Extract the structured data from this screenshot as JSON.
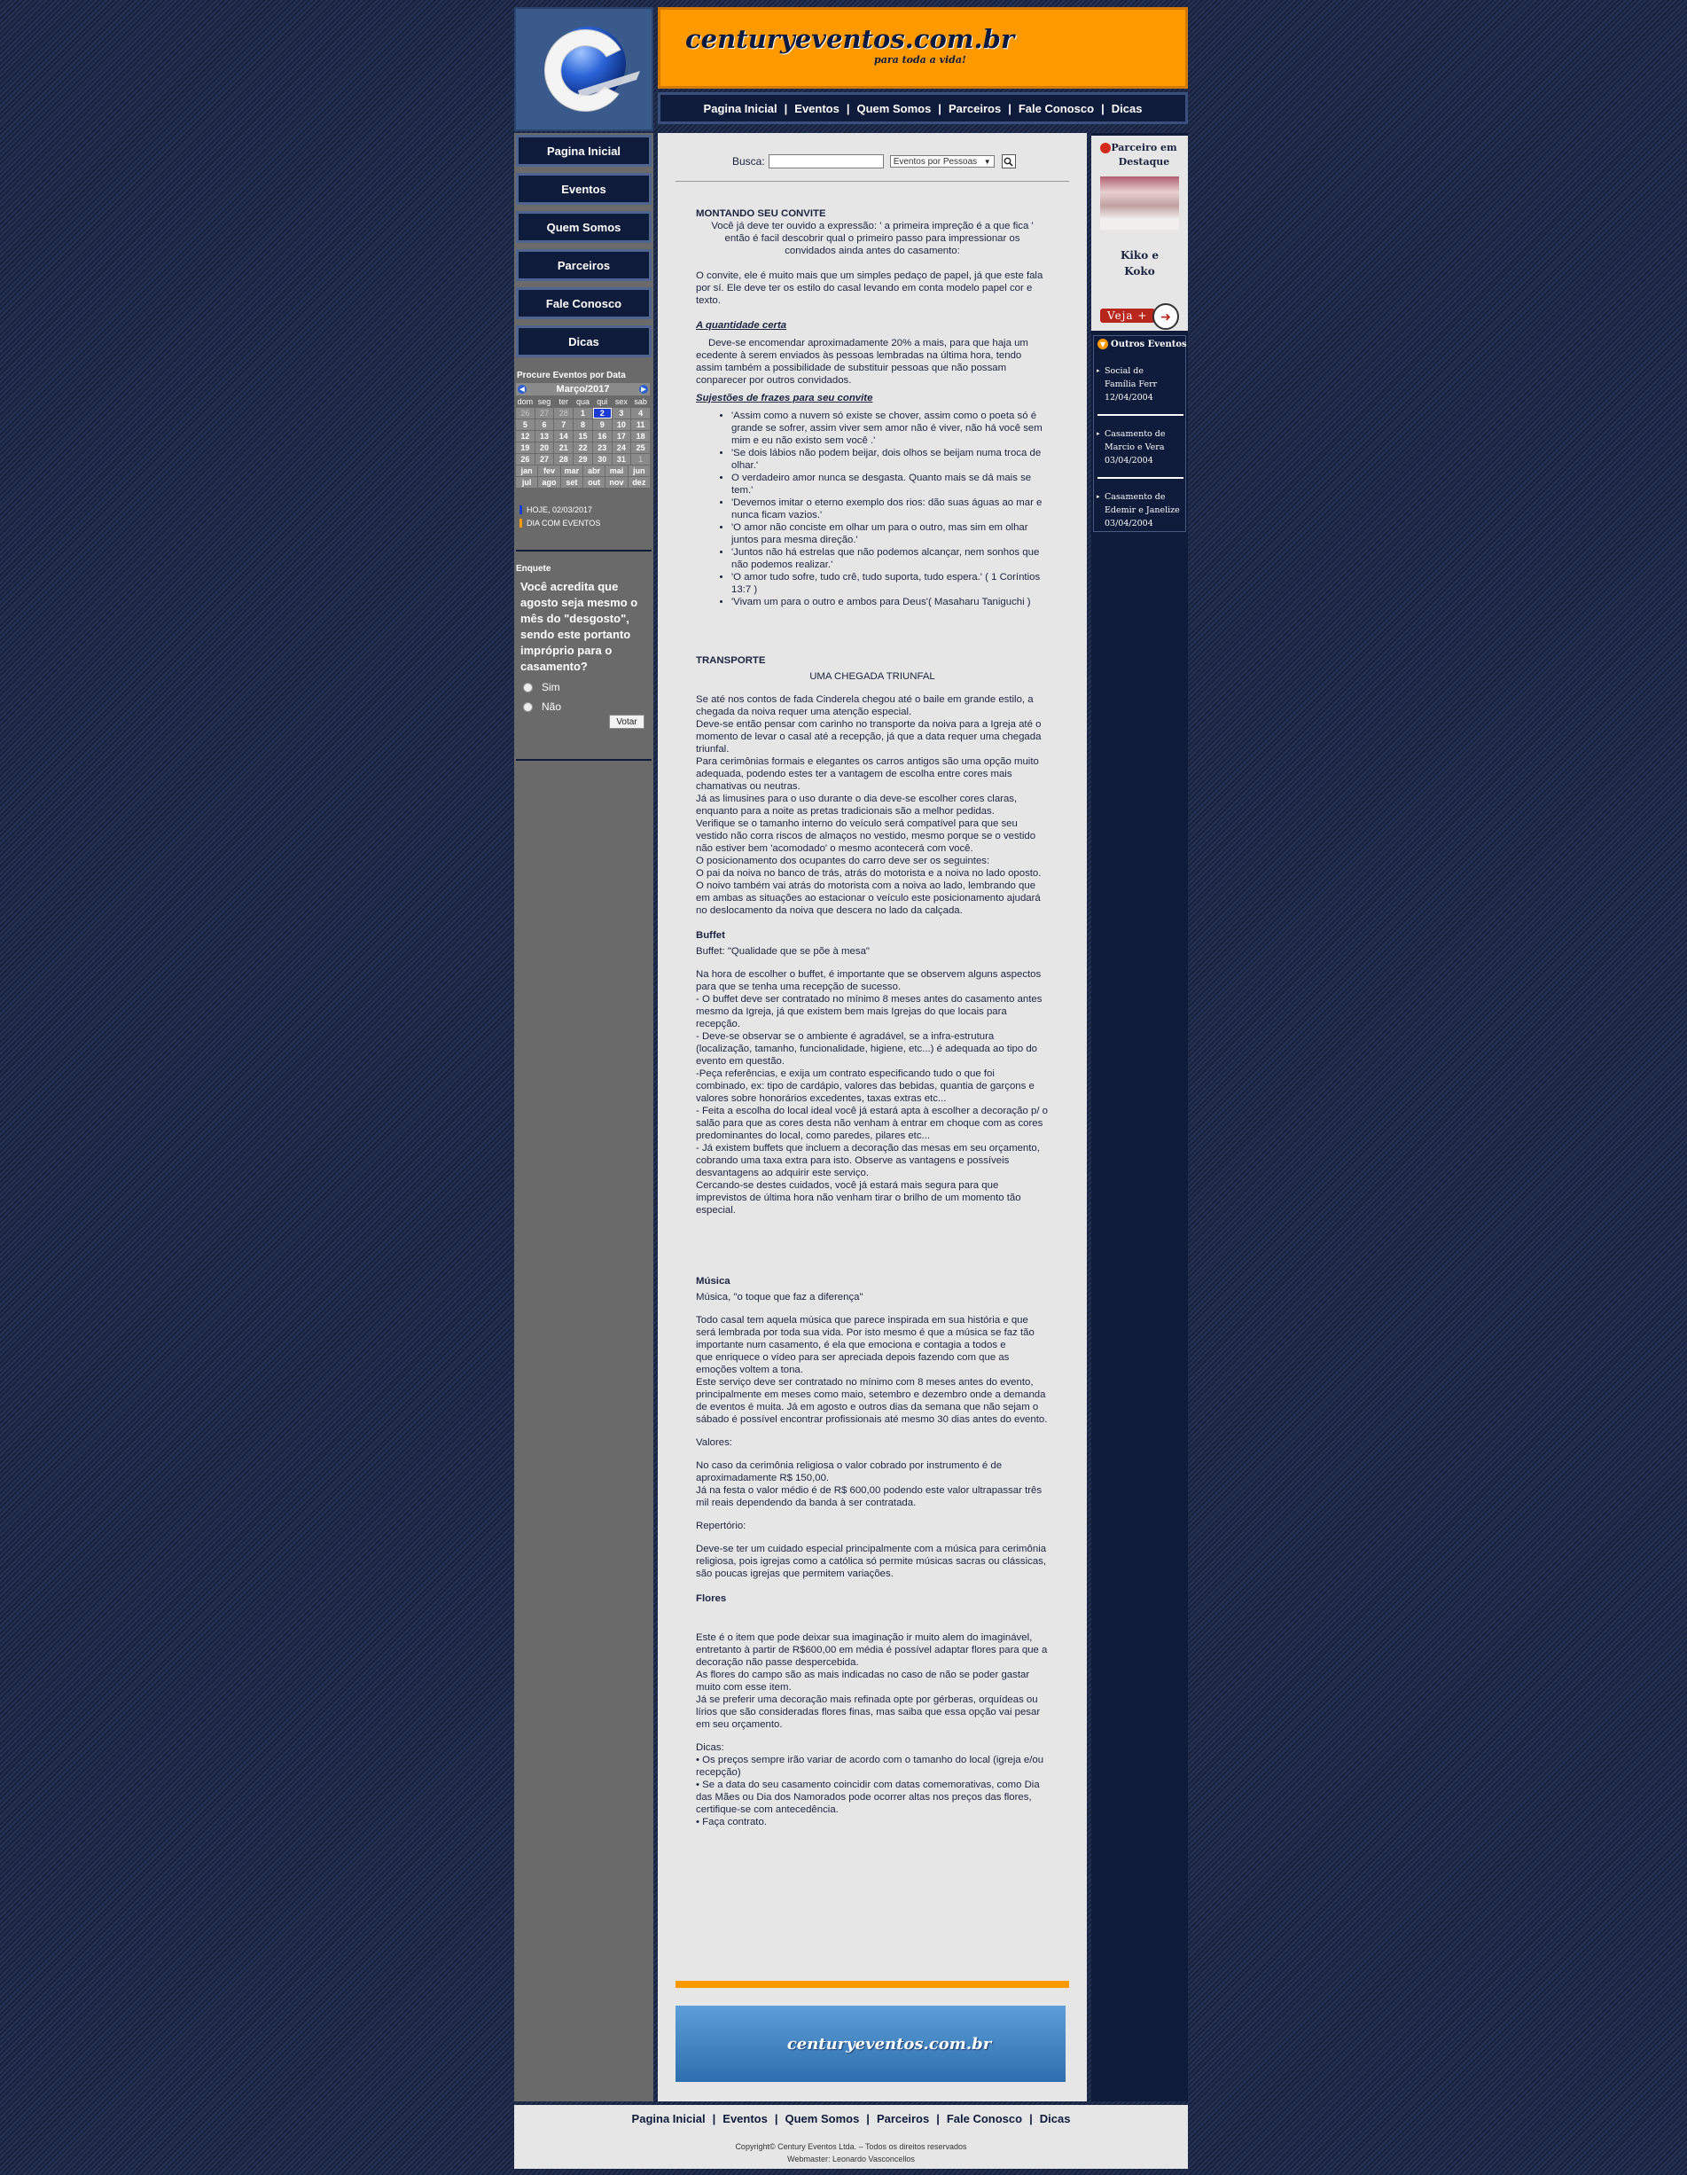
{
  "header": {
    "site_name": "centuryeventos.com.br",
    "slogan": "para toda a vida!",
    "logo_icon": "century-c-logo-icon"
  },
  "top_nav": [
    "Pagina Inicial",
    "Eventos",
    "Quem Somos",
    "Parceiros",
    "Fale Conosco",
    "Dicas"
  ],
  "side_nav": [
    "Pagina Inicial",
    "Eventos",
    "Quem Somos",
    "Parceiros",
    "Fale Conosco",
    "Dicas"
  ],
  "calendar": {
    "title": "Procure Eventos por Data",
    "month_label": "Março/2017",
    "weekdays": [
      "dom",
      "seg",
      "ter",
      "qua",
      "qui",
      "sex",
      "sab"
    ],
    "weeks": [
      [
        {
          "d": "26",
          "o": true
        },
        {
          "d": "27",
          "o": true
        },
        {
          "d": "28",
          "o": true
        },
        {
          "d": "1"
        },
        {
          "d": "2",
          "t": true
        },
        {
          "d": "3"
        },
        {
          "d": "4"
        }
      ],
      [
        {
          "d": "5"
        },
        {
          "d": "6"
        },
        {
          "d": "7"
        },
        {
          "d": "8"
        },
        {
          "d": "9"
        },
        {
          "d": "10"
        },
        {
          "d": "11"
        }
      ],
      [
        {
          "d": "12"
        },
        {
          "d": "13"
        },
        {
          "d": "14"
        },
        {
          "d": "15"
        },
        {
          "d": "16"
        },
        {
          "d": "17"
        },
        {
          "d": "18"
        }
      ],
      [
        {
          "d": "19"
        },
        {
          "d": "20"
        },
        {
          "d": "21"
        },
        {
          "d": "22"
        },
        {
          "d": "23"
        },
        {
          "d": "24"
        },
        {
          "d": "25"
        }
      ],
      [
        {
          "d": "26"
        },
        {
          "d": "27"
        },
        {
          "d": "28"
        },
        {
          "d": "29"
        },
        {
          "d": "30"
        },
        {
          "d": "31"
        },
        {
          "d": "1",
          "o": true
        }
      ]
    ],
    "months": [
      "jan",
      "fev",
      "mar",
      "abr",
      "mai",
      "jun",
      "jul",
      "ago",
      "set",
      "out",
      "nov",
      "dez"
    ],
    "today_label": "HOJE, 02/03/2017",
    "events_label": "DIA COM EVENTOS",
    "today_color": "#1b3bd6",
    "events_color": "#ff9900"
  },
  "poll": {
    "title": "Enquete",
    "question": "Você acredita que agosto seja mesmo o mês do \"desgosto\", sendo este portanto impróprio para o casamento?",
    "options": [
      "Sim",
      "Não"
    ],
    "vote_label": "Votar"
  },
  "search": {
    "label": "Busca:",
    "value": "",
    "select_value": "Eventos por Pessoas"
  },
  "article": {
    "convite": {
      "title": "MONTANDO SEU CONVITE",
      "intro": "Você já deve ter ouvido a expressão: ' a primeira impreção é a que fica ' então é facil descobrir qual o primeiro passo para impressionar os convidados ainda antes do casamento:",
      "p1": "O convite, ele é muito mais que um simples pedaço de papel, já que este fala por sí. Ele deve ter os estilo do casal levando em conta modelo papel cor e texto.",
      "qty_title": "A quantidade certa",
      "qty_text": "Deve-se encomendar aproximadamente 20% a mais, para que haja um ecedente à serem enviados às pessoas lembradas na última hora, tendo assim também a possibilidade de substituir pessoas que não possam conparecer por outros convidados.",
      "phrases_title": "Sujestões de frazes para seu convite",
      "phrases": [
        "'Assim como a nuvem só existe se chover, assim como o poeta só é grande se sofrer, assim viver sem amor não é viver, não há você sem mim e eu não existo sem você .'",
        "'Se dois lábios não podem beijar, dois olhos se beijam numa troca de olhar.'",
        "O verdadeiro amor nunca se desgasta. Quanto mais se dá mais se tem.'",
        "'Devemos imitar o eterno exemplo dos rios: dão suas águas ao mar e nunca ficam vazios.'",
        "'O amor não conciste em olhar um para o outro, mas sim em olhar juntos para mesma direção.'",
        "'Juntos não há estrelas que não podemos alcançar, nem sonhos que não podemos realizar.'",
        "'O amor tudo sofre, tudo crê, tudo suporta, tudo espera.' ( 1 Coríntios 13:7 )",
        "'Vivam um para o outro e ambos para Deus'( Masaharu Taniguchi )"
      ]
    },
    "transporte": {
      "title": "TRANSPORTE",
      "subtitle": "UMA CHEGADA TRIUNFAL",
      "lines": [
        "Se até nos contos de fada Cinderela chegou até o baile em grande estilo, a chegada da noiva requer uma atenção especial.",
        "Deve-se então pensar com carinho no transporte da noiva para a Igreja até o momento de levar o casal até a recepção, já que a data requer uma chegada triunfal.",
        "Para cerimônias formais e elegantes os carros antigos são uma opção muito adequada, podendo estes ter a vantagem de escolha entre cores mais chamativas ou neutras.",
        "Já as limusines para o uso durante o dia deve-se escolher cores claras, enquanto para a noite as pretas tradicionais são a melhor pedidas.",
        "Verifique se o tamanho interno do veículo será compatível para que seu vestido não corra riscos de almaços no vestido, mesmo porque se o vestido não estiver bem 'acomodado' o mesmo acontecerá com você.",
        "O posicionamento dos ocupantes do carro deve ser os seguintes:",
        "O pai da noiva no banco de trás, atrás do motorista e a noiva no lado oposto.",
        "O noivo também vai atrás do motorista com a noiva ao lado, lembrando que em ambas as situações ao estacionar o veículo este posicionamento ajudará no deslocamento da noiva que descera no lado da calçada."
      ]
    },
    "buffet": {
      "title": "Buffet",
      "subtitle": "Buffet: \"Qualidade que se põe à mesa\"",
      "lines": [
        "Na hora de escolher o buffet, é importante que se observem alguns aspectos para que se tenha uma recepção de sucesso.",
        "- O buffet deve ser contratado no mínimo 8 meses antes do casamento antes mesmo da Igreja, já que existem bem mais Igrejas do que locais para recepção.",
        "- Deve-se observar se o ambiente é agradável, se a infra-estrutura (localização, tamanho, funcionalidade, higiene, etc...) é adequada ao tipo do evento em questão.",
        "-Peça referências, e exija um contrato especificando tudo o que foi combinado, ex: tipo de cardápio, valores das bebidas, quantia de garçons e valores sobre honorários excedentes, taxas extras etc...",
        "- Feita a escolha do local ideal você já estará apta à escolher a decoração p/ o salão para que as cores desta não venham à entrar em choque com as cores predominantes do local, como paredes, pilares etc...",
        "- Já existem buffets que incluem a decoração das mesas em seu orçamento, cobrando uma taxa extra para isto. Observe as vantagens e possíveis desvantagens ao adquirir este serviço.",
        "Cercando-se destes cuidados, você já estará mais segura para que imprevistos de última hora não venham tirar o brilho de um momento tão especial."
      ]
    },
    "musica": {
      "title": "Música",
      "subtitle": "Música, \"o toque que faz a diferença\"",
      "p1": "Todo casal tem aquela música que parece inspirada em sua história e que será lembrada por toda sua vida. Por isto mesmo é que a música se faz tão importante num casamento, é ela que emociona e contagia a todos e",
      "p2": "que enriquece o vídeo para ser apreciada depois fazendo com que as emoções voltem a tona.",
      "p3": "Este serviço deve ser contratado no mínimo com 8 meses antes do evento, principalmente em meses como maio, setembro e dezembro onde a demanda de eventos é muita. Já em agosto e outros dias da semana que não sejam o sábado é possível encontrar profissionais até mesmo 30 dias antes do evento.",
      "valores_label": "Valores:",
      "valores_1": "No caso da cerimônia religiosa o valor cobrado por instrumento é de aproximadamente R$ 150,00.",
      "valores_2": "Já na festa o valor médio é de R$ 600,00 podendo este valor ultrapassar três mil reais dependendo da banda à ser contratada.",
      "repertorio_label": "Repertório:",
      "repertorio_text": "Deve-se ter um cuidado especial principalmente com a música para cerimônia religiosa, pois igrejas como a católica só permite músicas sacras ou clássicas, são poucas igrejas que permitem variações."
    },
    "flores": {
      "title": "Flores",
      "lines": [
        "Este é o item que pode deixar sua imaginação ir muito alem do imaginável, entretanto à partir de R$600,00 em média é possível adaptar flores para que a decoração não passe despercebida.",
        "As flores do campo são as mais indicadas no caso de não se poder gastar muito com esse item.",
        "Já se preferir uma decoração mais refinada opte por gérberas, orquídeas ou lírios que são consideradas flores finas, mas saiba que essa opção vai pesar em seu orçamento."
      ],
      "dicas_label": "Dicas:",
      "dicas": [
        "• Os preços sempre irão variar de acordo com o tamanho do local (igreja e/ou recepção)",
        "• Se a data do seu casamento coincidir com datas comemorativas, como Dia das Mães ou Dia dos Namorados pode ocorrer altas nos preços das flores, certifique-se com antecedência.",
        "• Faça contrato."
      ]
    }
  },
  "footer_banner": "centuryeventos.com.br",
  "partner": {
    "title": "Parceiro em Destaque",
    "name_line1": "Kiko e",
    "name_line2": "Koko",
    "button_label": "Veja +"
  },
  "other_events": {
    "title": "Outros Eventos",
    "items": [
      {
        "l1": "Social de",
        "l2": "Família Ferr",
        "date": "12/04/2004"
      },
      {
        "l1": "Casamento de",
        "l2": "Marcio e Vera",
        "date": "03/04/2004"
      },
      {
        "l1": "Casamento de",
        "l2": "Edemir e Janelize",
        "date": "03/04/2004"
      }
    ]
  },
  "footer": {
    "nav": [
      "Pagina Inicial",
      "Eventos",
      "Quem Somos",
      "Parceiros",
      "Fale Conosco",
      "Dicas"
    ],
    "copyright": "Copyright© Century Eventos Ltda. – Todos os direitos reservados",
    "webmaster": "Webmaster: Leonardo Vasconcellos"
  }
}
